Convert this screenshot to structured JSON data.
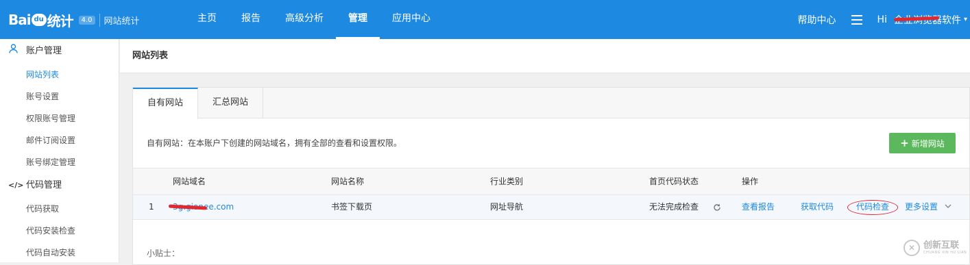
{
  "brand": {
    "logo_text_left": "Bai",
    "logo_paw": "du",
    "logo_text_right": "统计",
    "version": "4.0",
    "subtitle": "网站统计"
  },
  "nav": {
    "items": [
      {
        "label": "主页"
      },
      {
        "label": "报告"
      },
      {
        "label": "高级分析"
      },
      {
        "label": "管理"
      },
      {
        "label": "应用中心"
      }
    ],
    "active": "管理"
  },
  "topright": {
    "help": "帮助中心",
    "menu_icon": "list-icon",
    "greeting": "Hi",
    "username": "企业浏览器软件",
    "caret": "▾"
  },
  "sidebar": {
    "groups": [
      {
        "label": "账户管理",
        "icon": "user-icon",
        "items": [
          "网站列表",
          "账号设置",
          "权限账号管理",
          "邮件订阅设置",
          "账号绑定管理"
        ]
      },
      {
        "label": "代码管理",
        "icon": "code-icon",
        "items": [
          "代码获取",
          "代码安装检查",
          "代码自动安装"
        ]
      }
    ],
    "active_item": "网站列表"
  },
  "page": {
    "title": "网站列表"
  },
  "tabs": [
    {
      "label": "自有网站"
    },
    {
      "label": "汇总网站"
    }
  ],
  "panel": {
    "description": "自有网站：在本账户下创建的网站域名，拥有全部的查看和设置权限。",
    "add_button": "新增网站",
    "add_icon": "plus-icon",
    "tips": "小贴士："
  },
  "table": {
    "headers": {
      "domain": "网站域名",
      "name": "网站名称",
      "industry": "行业类别",
      "status": "首页代码状态",
      "actions": "操作"
    },
    "rows": [
      {
        "index": "1",
        "domain": "3g.gionee.com",
        "name": "书签下载页",
        "industry": "网址导航",
        "status": "无法完成检查",
        "actions": [
          "查看报告",
          "获取代码",
          "代码检查",
          "更多设置"
        ]
      }
    ]
  },
  "watermark": {
    "text": "创新互联",
    "sub": "CHUANG XIN HU LIAN",
    "icon": "logo-x-icon"
  },
  "colors": {
    "primary": "#1e89e0",
    "success": "#5cb85c",
    "annotation": "#e0282e"
  }
}
